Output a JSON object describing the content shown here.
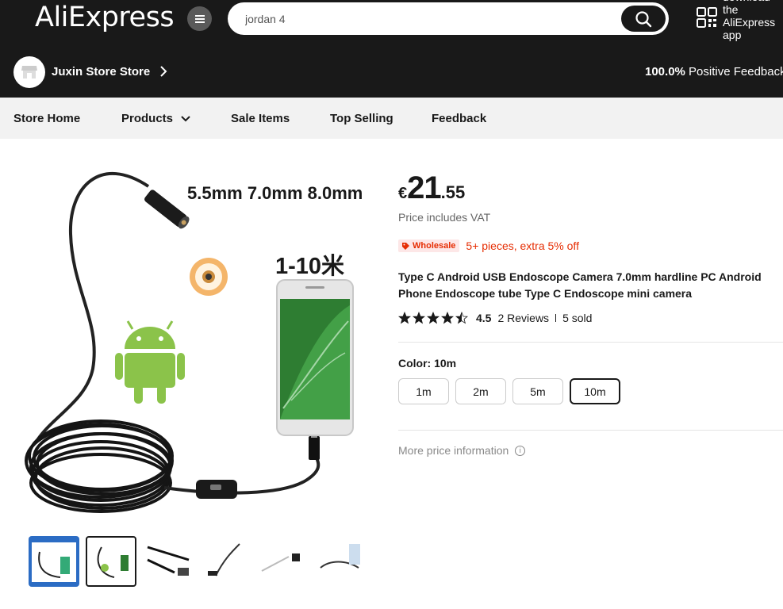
{
  "header": {
    "logo": "AliExpress",
    "search_value": "jordan 4",
    "app_download": [
      "download",
      "the",
      "AliExpress",
      "app"
    ]
  },
  "store": {
    "name": "Juxin Store Store",
    "feedback_percent": "100.0%",
    "feedback_label": "Positive Feedback"
  },
  "store_nav": {
    "items": [
      "Store Home",
      "Products",
      "Sale Items",
      "Top Selling",
      "Feedback"
    ]
  },
  "image": {
    "overlay_sizes": "5.5mm 7.0mm 8.0mm",
    "overlay_length": "1-10米"
  },
  "product": {
    "currency": "€",
    "price_int": "21",
    "price_dec": ".55",
    "vat_note": "Price includes VAT",
    "wholesale_badge": "Wholesale",
    "wholesale_text": "5+ pieces, extra 5% off",
    "title_line1": "Type C Android USB Endoscope Camera 7.0mm hardline PC Android",
    "title_line2": "Phone Endoscope tube Type C Endoscope mini camera",
    "rating": "4.5",
    "rating_value": 4.5,
    "reviews": "2 Reviews",
    "sold": "5 sold",
    "color_label": "Color: 10m",
    "color_options": [
      "1m",
      "2m",
      "5m",
      "10m"
    ],
    "selected_option": "10m",
    "more_price": "More price information",
    "info_icon": "i"
  },
  "colors": {
    "header_bg": "#191919",
    "accent_red": "#e62e04",
    "nav_bg": "#f2f2f2"
  }
}
